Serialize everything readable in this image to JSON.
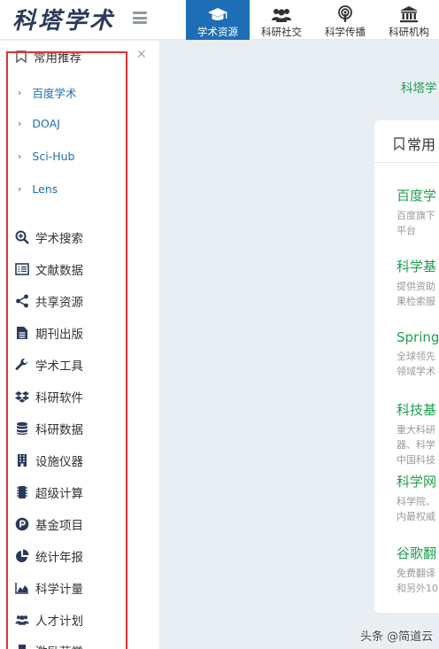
{
  "logo": "科塔学术",
  "nav": [
    {
      "label": "学术资源",
      "icon": "graduation-cap-icon",
      "active": true
    },
    {
      "label": "科研社交",
      "icon": "users-icon",
      "active": false
    },
    {
      "label": "科学传播",
      "icon": "podcast-icon",
      "active": false
    },
    {
      "label": "科研机构",
      "icon": "institution-icon",
      "active": false
    }
  ],
  "sidebar": {
    "group_title": "常用推荐",
    "sub_items": [
      "百度学术",
      "DOAJ",
      "Sci-Hub",
      "Lens"
    ],
    "items": [
      {
        "label": "学术搜索",
        "icon": "search-plus-icon"
      },
      {
        "label": "文献数据",
        "icon": "list-alt-icon"
      },
      {
        "label": "共享资源",
        "icon": "share-alt-icon"
      },
      {
        "label": "期刊出版",
        "icon": "file-text-icon"
      },
      {
        "label": "学术工具",
        "icon": "wrench-icon"
      },
      {
        "label": "科研软件",
        "icon": "dropbox-icon"
      },
      {
        "label": "科研数据",
        "icon": "database-icon"
      },
      {
        "label": "设施仪器",
        "icon": "building-icon"
      },
      {
        "label": "超级计算",
        "icon": "microchip-icon"
      },
      {
        "label": "基金项目",
        "icon": "product-hunt-icon"
      },
      {
        "label": "统计年报",
        "icon": "pie-chart-icon"
      },
      {
        "label": "科学计量",
        "icon": "area-chart-icon"
      },
      {
        "label": "人才计划",
        "icon": "users-icon"
      },
      {
        "label": "激励荣誉",
        "icon": "trophy-icon"
      }
    ]
  },
  "main": {
    "top_link": "科塔学",
    "card_title": "常用",
    "entries": [
      {
        "title": "百度学",
        "desc": [
          "百度旗下",
          "平台"
        ]
      },
      {
        "title": "科学基",
        "desc": [
          "提供资助",
          "果检索服"
        ]
      },
      {
        "title": "Spring",
        "desc": [
          "全球领先",
          "领域学术"
        ]
      },
      {
        "title": "科技基",
        "desc": [
          "重大科研",
          "器、科学",
          "中国科技"
        ]
      },
      {
        "title": "科学网",
        "desc": [
          "科学院、",
          "内最权威"
        ]
      },
      {
        "title": "谷歌翻",
        "desc": [
          "免费翻译",
          "和另外10"
        ]
      }
    ]
  },
  "watermark": "头条 @简道云",
  "colors": {
    "accent": "#1e6eb5",
    "link_green": "#1e9e4e",
    "highlight_red": "#e03232"
  }
}
